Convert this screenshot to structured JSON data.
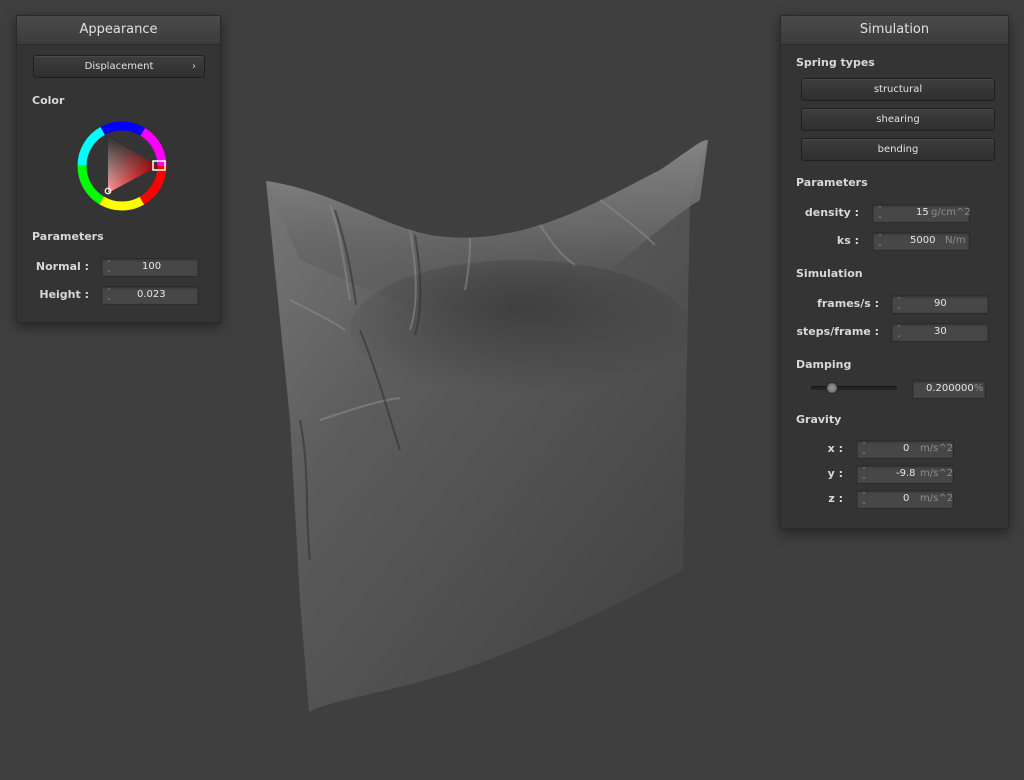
{
  "appearance": {
    "title": "Appearance",
    "shader_dropdown": {
      "value": "Displacement",
      "arrow": "›"
    },
    "color_label": "Color",
    "parameters_label": "Parameters",
    "normal": {
      "label": "Normal :",
      "value": "100"
    },
    "height": {
      "label": "Height :",
      "value": "0.023"
    }
  },
  "simulation": {
    "title": "Simulation",
    "spring_types_label": "Spring types",
    "springs": [
      {
        "label": "structural"
      },
      {
        "label": "shearing"
      },
      {
        "label": "bending"
      }
    ],
    "parameters_label": "Parameters",
    "density": {
      "label": "density :",
      "value": "15",
      "unit": "g/cm^2"
    },
    "ks": {
      "label": "ks :",
      "value": "5000",
      "unit": "N/m"
    },
    "simulation_label": "Simulation",
    "frames_per_s": {
      "label": "frames/s :",
      "value": "90"
    },
    "steps_per_frame": {
      "label": "steps/frame :",
      "value": "30"
    },
    "damping_label": "Damping",
    "damping": {
      "value": "0.200000",
      "unit": "%",
      "slider_fraction": 0.2
    },
    "gravity_label": "Gravity",
    "gravity": {
      "x": {
        "label": "x :",
        "value": "0",
        "unit": "m/s^2"
      },
      "y": {
        "label": "y :",
        "value": "-9.8",
        "unit": "m/s^2"
      },
      "z": {
        "label": "z :",
        "value": "0",
        "unit": "m/s^2"
      }
    }
  },
  "colors": {
    "background": "#3f3f3f",
    "panel": "#343434",
    "cloth": "#6a6a6a",
    "picked_color": "#ff0000"
  },
  "icons": {
    "spinner": "spinner-icon",
    "dropdown": "chevron-right-icon"
  }
}
